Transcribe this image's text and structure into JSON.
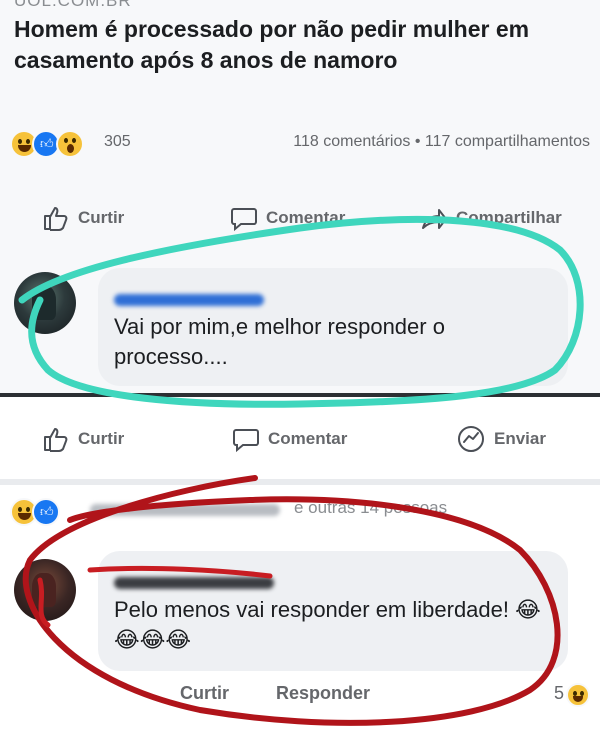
{
  "post": {
    "source_cut": "UOL.COM.BR",
    "headline": "Homem é processado por não pedir mulher em casamento após 8 anos de namoro",
    "reaction_count": "305",
    "comments_shares": "118 comentários • 117 compartilhamentos",
    "actions": {
      "like": "Curtir",
      "comment": "Comentar",
      "share": "Compartilhar"
    }
  },
  "comment1": {
    "text": "Vai por mim,e melhor responder o processo....",
    "actions": {
      "like": "Curtir",
      "comment": "Comentar",
      "send": "Enviar"
    }
  },
  "reacted_row": {
    "others": "e outras 14 pessoas"
  },
  "comment2": {
    "text": "Pelo menos vai responder em liberdade!",
    "emojis": "😂😂😂😂",
    "actions": {
      "like": "Curtir",
      "reply": "Responder"
    },
    "reaction_count": "5"
  },
  "colors": {
    "annotation_teal": "#3fd6bd",
    "annotation_red": "#b0141a",
    "facebook_blue": "#1877f2",
    "text_gray": "#65676b"
  }
}
